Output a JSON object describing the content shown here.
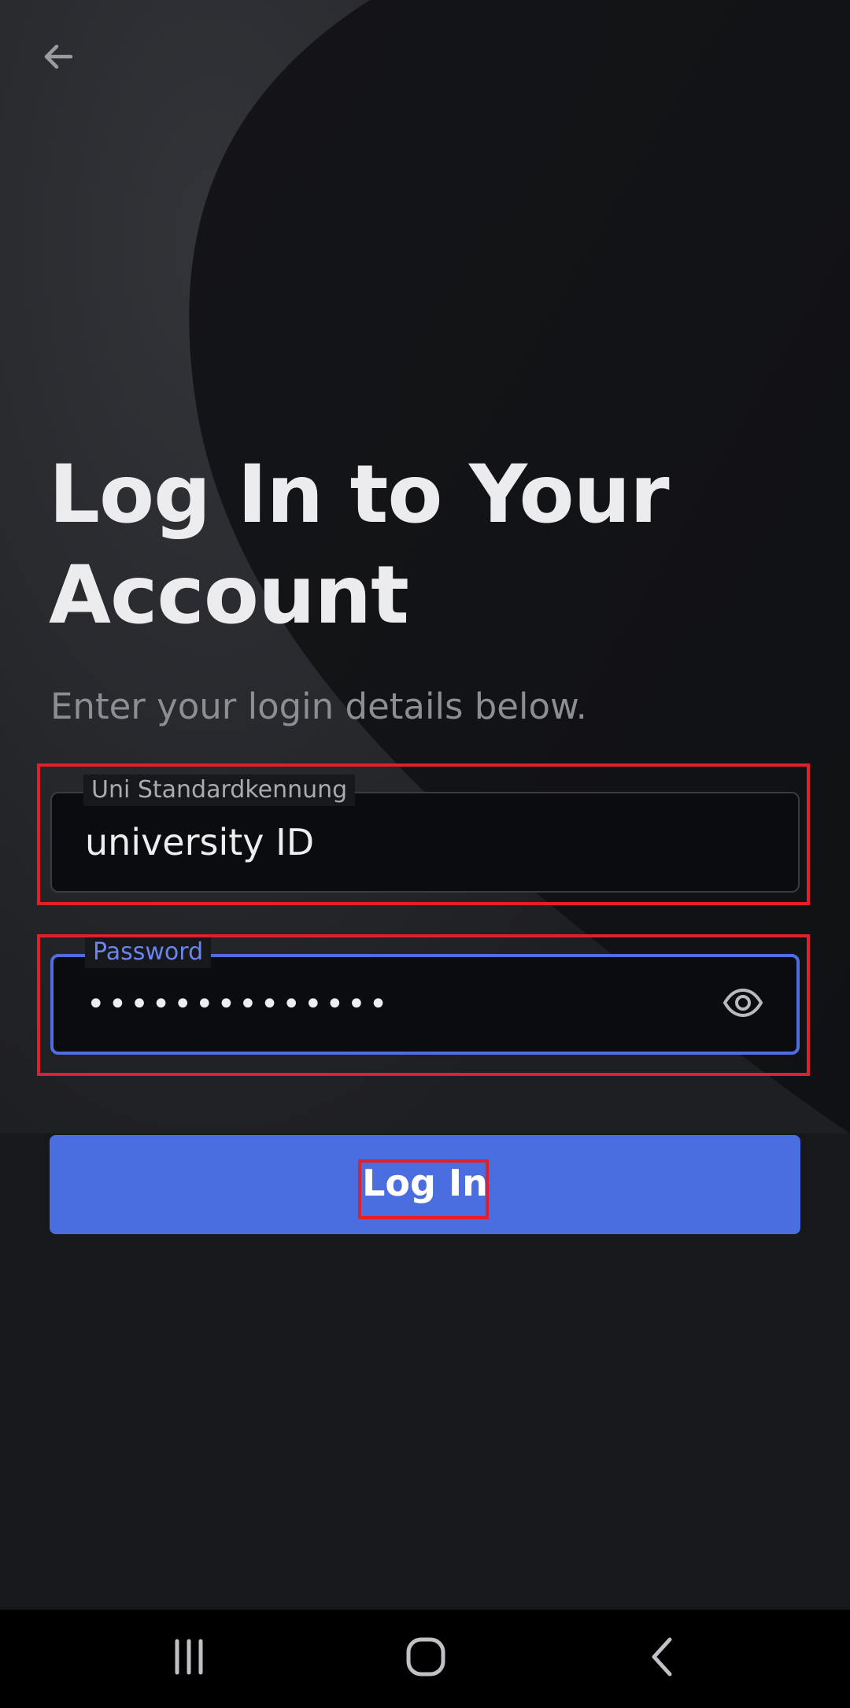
{
  "screen": {
    "title_line1": "Log In to Your",
    "title_line2": "Account",
    "subtitle": "Enter your login details below."
  },
  "form": {
    "username": {
      "label": "Uni Standardkennung",
      "value": "university ID"
    },
    "password": {
      "label": "Password",
      "masked_value": "••••••••••••••"
    },
    "submit_label": "Log In"
  },
  "icons": {
    "back": "arrow-left-icon",
    "reveal_password": "eye-icon",
    "nav_recents": "recents-icon",
    "nav_home": "home-icon",
    "nav_back": "chevron-left-icon"
  },
  "colors": {
    "background": "#17181c",
    "accent": "#4a6ee0",
    "focused_border": "#4f6fe0",
    "highlight": "#e2202c"
  }
}
